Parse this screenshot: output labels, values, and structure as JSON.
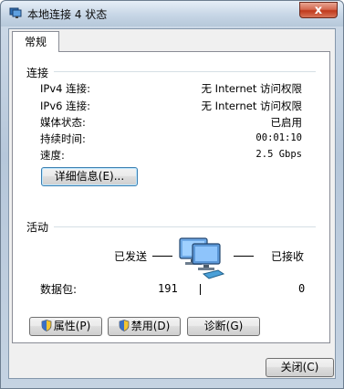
{
  "window": {
    "title": "本地连接 4 状态",
    "close_glyph": "x"
  },
  "tabs": [
    {
      "label": "常规"
    }
  ],
  "connection": {
    "heading": "连接",
    "rows": [
      {
        "label": "IPv4 连接:",
        "value": "无 Internet 访问权限"
      },
      {
        "label": "IPv6 连接:",
        "value": "无 Internet 访问权限"
      },
      {
        "label": "媒体状态:",
        "value": "已启用"
      },
      {
        "label": "持续时间:",
        "value": "00:01:10"
      },
      {
        "label": "速度:",
        "value": "2.5 Gbps"
      }
    ],
    "details_button": "详细信息(E)..."
  },
  "activity": {
    "heading": "活动",
    "sent_label": "已发送",
    "received_label": "已接收",
    "packets_label": "数据包:",
    "packets_sent": "191",
    "packets_received": "0"
  },
  "actions": {
    "properties": "属性(P)",
    "disable": "禁用(D)",
    "diagnose": "诊断(G)"
  },
  "footer": {
    "close_button": "关闭(C)"
  },
  "colors": {
    "title_bar": "#c7d6e6",
    "close_red": "#c0391c",
    "group_line": "#d5dfe5"
  }
}
